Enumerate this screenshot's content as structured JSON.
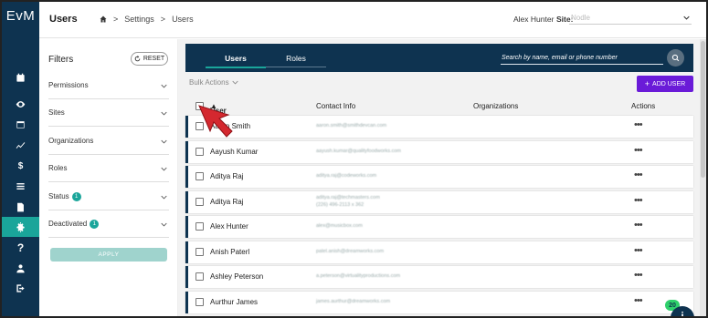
{
  "app": {
    "logo": "EvM"
  },
  "header": {
    "title": "Users",
    "breadcrumb": [
      "Settings",
      "Users"
    ],
    "breadcrumb_sep": ">",
    "user_name": "Alex Hunter",
    "site_label": "Site:",
    "site_value": "Nodle"
  },
  "rail": {
    "items": [
      {
        "icon": "calendar-icon"
      },
      {
        "icon": "eye-icon"
      },
      {
        "icon": "calendar-icon"
      },
      {
        "icon": "trend-icon"
      },
      {
        "icon": "dollar-icon"
      },
      {
        "icon": "list-icon"
      },
      {
        "icon": "document-icon"
      },
      {
        "icon": "gear-icon"
      },
      {
        "icon": "help-icon"
      },
      {
        "icon": "user-icon"
      },
      {
        "icon": "logout-icon"
      }
    ],
    "active_index": 7
  },
  "filters": {
    "title": "Filters",
    "reset_label": "RESET",
    "items": [
      {
        "label": "Permissions",
        "badge": ""
      },
      {
        "label": "Sites",
        "badge": ""
      },
      {
        "label": "Organizations",
        "badge": ""
      },
      {
        "label": "Roles",
        "badge": ""
      },
      {
        "label": "Status",
        "badge": "1"
      },
      {
        "label": "Deactivated",
        "badge": "1"
      }
    ],
    "apply_label": "APPLY"
  },
  "tabs": [
    {
      "label": "Users",
      "active": true
    },
    {
      "label": "Roles",
      "active": false
    }
  ],
  "search": {
    "placeholder": "Search by name, email or phone number"
  },
  "toolbar": {
    "bulk_actions": "Bulk Actions",
    "add_user": "ADD USER"
  },
  "table": {
    "columns": [
      "User Name",
      "Contact Info",
      "Organizations",
      "Actions"
    ],
    "rows": [
      {
        "name": "Aaron Smith",
        "contact": [
          "aaron.smith@smithdevcan.com"
        ],
        "actions": "•••"
      },
      {
        "name": "Aayush Kumar",
        "contact": [
          "aayush.kumar@qualityfoodworks.com"
        ],
        "actions": "•••"
      },
      {
        "name": "Aditya Raj",
        "contact": [
          "aditya.raj@codeworks.com"
        ],
        "actions": "•••"
      },
      {
        "name": "Aditya Raj",
        "contact": [
          "aditya.raj@techmasters.com",
          "(226) 496-2113 x 362"
        ],
        "actions": "•••"
      },
      {
        "name": "Alex Hunter",
        "contact": [
          "alex@musicbox.com"
        ],
        "actions": "•••"
      },
      {
        "name": "Anish Paterl",
        "contact": [
          "patel.anish@dreamworks.com"
        ],
        "actions": "•••"
      },
      {
        "name": "Ashley Peterson",
        "contact": [
          "a.peterson@virtualityproductions.com"
        ],
        "actions": "•••"
      },
      {
        "name": "Aurthur James",
        "contact": [
          "james.aurthur@dreamworks.com"
        ],
        "actions": "•••"
      }
    ]
  },
  "notification": {
    "count": "20"
  },
  "colors": {
    "navy": "#0e3350",
    "teal": "#1aa59a",
    "purple": "#6a1bd8"
  }
}
